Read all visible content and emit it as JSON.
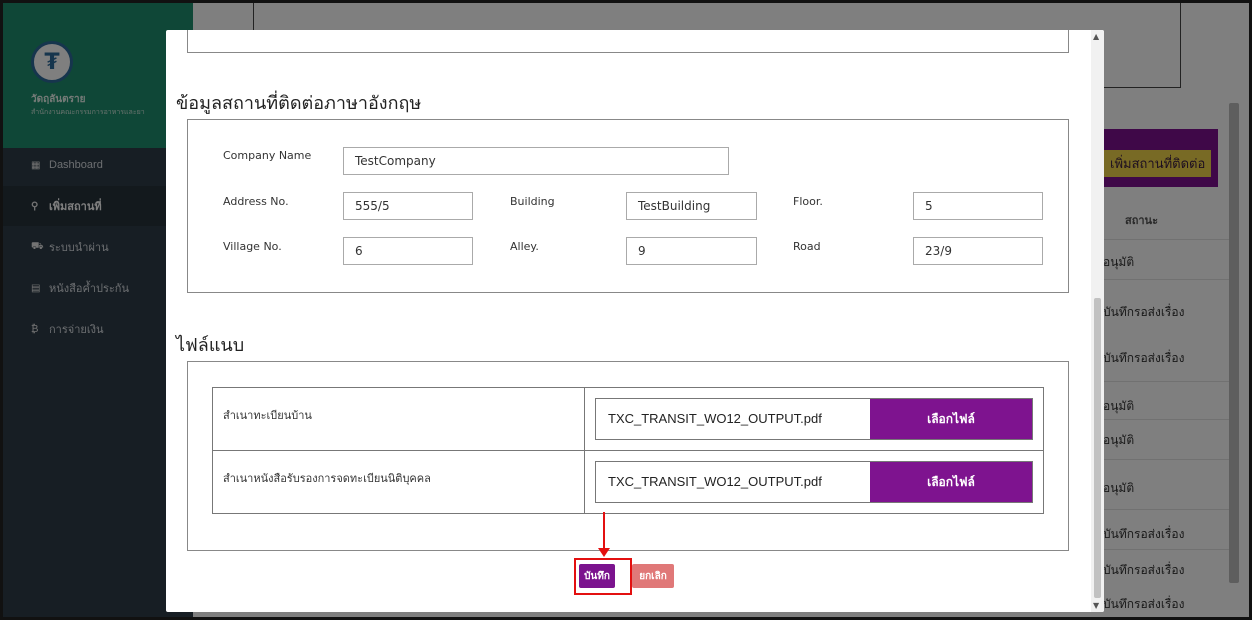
{
  "sidebar": {
    "brand_title": "วัดฤลันตราย",
    "brand_subtitle": "สำนักงานคณะกรรมการอาหารและยา",
    "items": [
      {
        "label": "Dashboard",
        "icon": "grid-icon"
      },
      {
        "label": "เพิ่มสถานที่",
        "icon": "map-pin-icon"
      },
      {
        "label": "ระบบนำผ่าน",
        "icon": "truck-icon"
      },
      {
        "label": "หนังสือค้ำประกัน",
        "icon": "book-icon"
      },
      {
        "label": "การจ่ายเงิน",
        "icon": "money-icon"
      }
    ]
  },
  "background": {
    "add_button": "เพิ่มสถานที่ติดต่อ",
    "status_header": "สถานะ",
    "status_rows": [
      "อนุมัติ",
      "บันทึกรอส่งเรื่อง",
      "บันทึกรอส่งเรื่อง",
      "อนุมัติ",
      "อนุมัติ",
      "อนุมัติ",
      "บันทึกรอส่งเรื่อง",
      "บันทึกรอส่งเรื่อง",
      "บันทึกรอส่งเรื่อง"
    ]
  },
  "modal": {
    "english_section_title": "ข้อมูลสถานที่ติดต่อภาษาอังกฤษ",
    "fields": {
      "company_name": {
        "label": "Company Name",
        "value": "TestCompany"
      },
      "address_no": {
        "label": "Address No.",
        "value": "555/5"
      },
      "building": {
        "label": "Building",
        "value": "TestBuilding"
      },
      "floor": {
        "label": "Floor.",
        "value": "5"
      },
      "village_no": {
        "label": "Village No.",
        "value": "6"
      },
      "alley": {
        "label": "Alley.",
        "value": "9"
      },
      "road": {
        "label": "Road",
        "value": "23/9"
      }
    },
    "attachments_title": "ไฟล์แนบ",
    "attachments": [
      {
        "name": "สำเนาทะเบียนบ้าน",
        "file": "TXC_TRANSIT_WO12_OUTPUT.pdf",
        "button": "เลือกไฟล์"
      },
      {
        "name": "สำเนาหนังสือรับรองการจดทะเบียนนิติบุคคล",
        "file": "TXC_TRANSIT_WO12_OUTPUT.pdf",
        "button": "เลือกไฟล์"
      }
    ],
    "save_label": "บันทึก",
    "cancel_label": "ยกเลิก"
  },
  "colors": {
    "primary_purple": "#7e138f",
    "cancel_red": "#e07878",
    "highlight_red": "#e31010",
    "sidebar_bg": "#2f3d48",
    "brand_green": "#1f8e6f"
  }
}
